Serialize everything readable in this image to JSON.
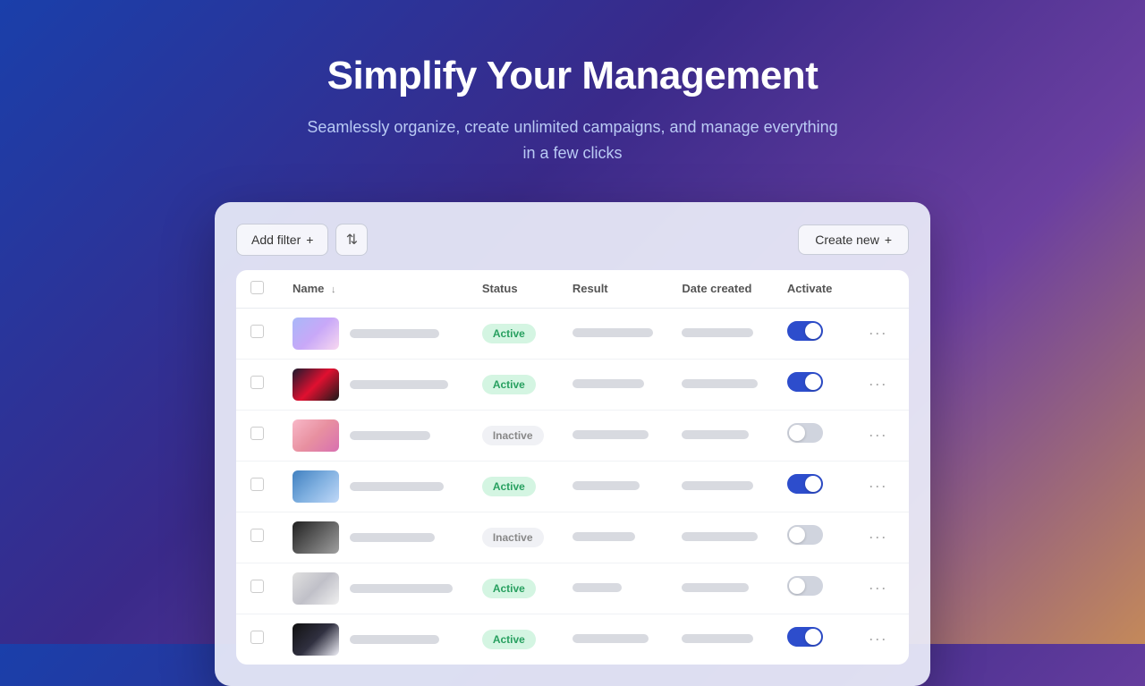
{
  "hero": {
    "title": "Simplify Your Management",
    "subtitle": "Seamlessly organize, create unlimited campaigns, and manage everything in a few clicks"
  },
  "toolbar": {
    "add_filter_label": "Add filter",
    "add_filter_icon": "+",
    "sort_icon": "⇅",
    "create_new_label": "Create new",
    "create_new_icon": "+"
  },
  "table": {
    "columns": [
      {
        "key": "checkbox",
        "label": ""
      },
      {
        "key": "name",
        "label": "Name",
        "sort": true
      },
      {
        "key": "status",
        "label": "Status"
      },
      {
        "key": "result",
        "label": "Result"
      },
      {
        "key": "date_created",
        "label": "Date created"
      },
      {
        "key": "activate",
        "label": "Activate"
      },
      {
        "key": "actions",
        "label": ""
      }
    ],
    "rows": [
      {
        "id": 1,
        "thumb": "thumb-1",
        "name_bar_width": 100,
        "status": "Active",
        "status_type": "active",
        "result_bar_width": 90,
        "date_bar_width": 80,
        "toggle": "on"
      },
      {
        "id": 2,
        "thumb": "thumb-2",
        "name_bar_width": 110,
        "status": "Active",
        "status_type": "active",
        "result_bar_width": 80,
        "date_bar_width": 85,
        "toggle": "on"
      },
      {
        "id": 3,
        "thumb": "thumb-3",
        "name_bar_width": 90,
        "status": "Inactive",
        "status_type": "inactive",
        "result_bar_width": 85,
        "date_bar_width": 75,
        "toggle": "off"
      },
      {
        "id": 4,
        "thumb": "thumb-4",
        "name_bar_width": 105,
        "status": "Active",
        "status_type": "active",
        "result_bar_width": 75,
        "date_bar_width": 80,
        "toggle": "on"
      },
      {
        "id": 5,
        "thumb": "thumb-5",
        "name_bar_width": 95,
        "status": "Inactive",
        "status_type": "inactive",
        "result_bar_width": 70,
        "date_bar_width": 85,
        "toggle": "off"
      },
      {
        "id": 6,
        "thumb": "thumb-6",
        "name_bar_width": 115,
        "status": "Active",
        "status_type": "active",
        "result_bar_width": 55,
        "date_bar_width": 75,
        "toggle": "off"
      },
      {
        "id": 7,
        "thumb": "thumb-7",
        "name_bar_width": 100,
        "status": "Active",
        "status_type": "active",
        "result_bar_width": 85,
        "date_bar_width": 80,
        "toggle": "on"
      }
    ]
  }
}
